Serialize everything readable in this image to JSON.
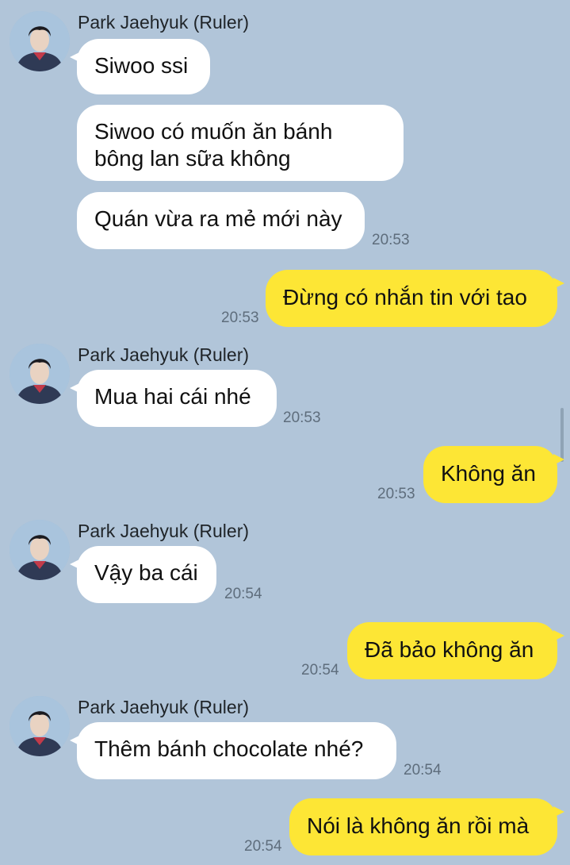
{
  "colors": {
    "background": "#b1c5d9",
    "incoming_bubble": "#ffffff",
    "outgoing_bubble": "#fde635",
    "timestamp": "#5e6d7c"
  },
  "chat": {
    "sender_name": "Park Jaehyuk (Ruler)",
    "messages": [
      {
        "dir": "in",
        "text": "Siwoo ssi"
      },
      {
        "dir": "in",
        "text": "Siwoo có muốn ăn bánh bông lan sữa không"
      },
      {
        "dir": "in",
        "text": "Quán vừa ra mẻ mới này",
        "time": "20:53"
      },
      {
        "dir": "out",
        "text": "Đừng có nhắn tin với tao",
        "time": "20:53"
      },
      {
        "dir": "in",
        "text": "Mua hai cái nhé",
        "time": "20:53"
      },
      {
        "dir": "out",
        "text": "Không ăn",
        "time": "20:53"
      },
      {
        "dir": "in",
        "text": "Vậy ba cái",
        "time": "20:54"
      },
      {
        "dir": "out",
        "text": "Đã bảo không ăn",
        "time": "20:54"
      },
      {
        "dir": "in",
        "text": "Thêm bánh chocolate nhé?",
        "time": "20:54"
      },
      {
        "dir": "out",
        "text": "Nói là không ăn rồi mà",
        "time": "20:54"
      }
    ]
  }
}
